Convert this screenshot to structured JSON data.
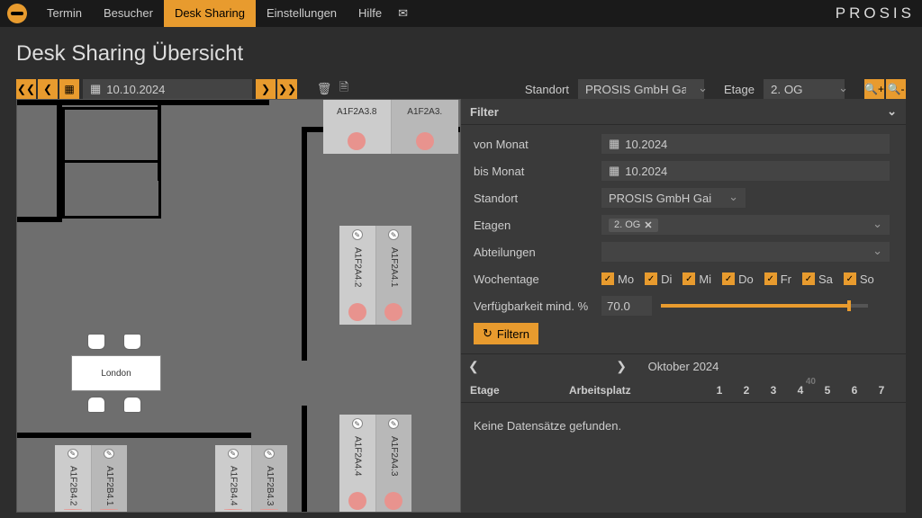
{
  "nav": {
    "items": [
      "Termin",
      "Besucher",
      "Desk Sharing",
      "Einstellungen",
      "Hilfe"
    ],
    "active": 2
  },
  "brand": "PROSIS",
  "page_title": "Desk Sharing Übersicht",
  "toolbar": {
    "date": "10.10.2024",
    "standort_lbl": "Standort",
    "standort_val": "PROSIS GmbH Gai",
    "etage_lbl": "Etage",
    "etage_val": "2. OG"
  },
  "floor": {
    "room_label": "London",
    "desks_top": [
      "A1F2A3.8",
      "A1F2A3."
    ],
    "desks_mid": [
      "A1F2A4.2",
      "A1F2A4.1"
    ],
    "desks_bl": [
      "A1F2B4.2",
      "A1F2B4.1"
    ],
    "desks_br": [
      "A1F2B4.4",
      "A1F2B4.3"
    ],
    "desks_r": [
      "A1F2A4.4",
      "A1F2A4.3"
    ]
  },
  "filter": {
    "title": "Filter",
    "von_lbl": "von Monat",
    "von_val": "10.2024",
    "bis_lbl": "bis Monat",
    "bis_val": "10.2024",
    "standort_lbl": "Standort",
    "standort_val": "PROSIS GmbH Gai",
    "etagen_lbl": "Etagen",
    "etagen_tag": "2. OG",
    "abt_lbl": "Abteilungen",
    "wtage_lbl": "Wochentage",
    "days": [
      "Mo",
      "Di",
      "Mi",
      "Do",
      "Fr",
      "Sa",
      "So"
    ],
    "verf_lbl": "Verfügbarkeit mind. %",
    "verf_val": "70.0",
    "verf_pct": 70,
    "btn": "Filtern"
  },
  "month": {
    "label": "Oktober 2024",
    "kw": "40"
  },
  "table": {
    "col1": "Etage",
    "col2": "Arbeitsplatz",
    "days": [
      "1",
      "2",
      "3",
      "4",
      "5",
      "6",
      "7"
    ],
    "empty": "Keine Datensätze gefunden."
  }
}
